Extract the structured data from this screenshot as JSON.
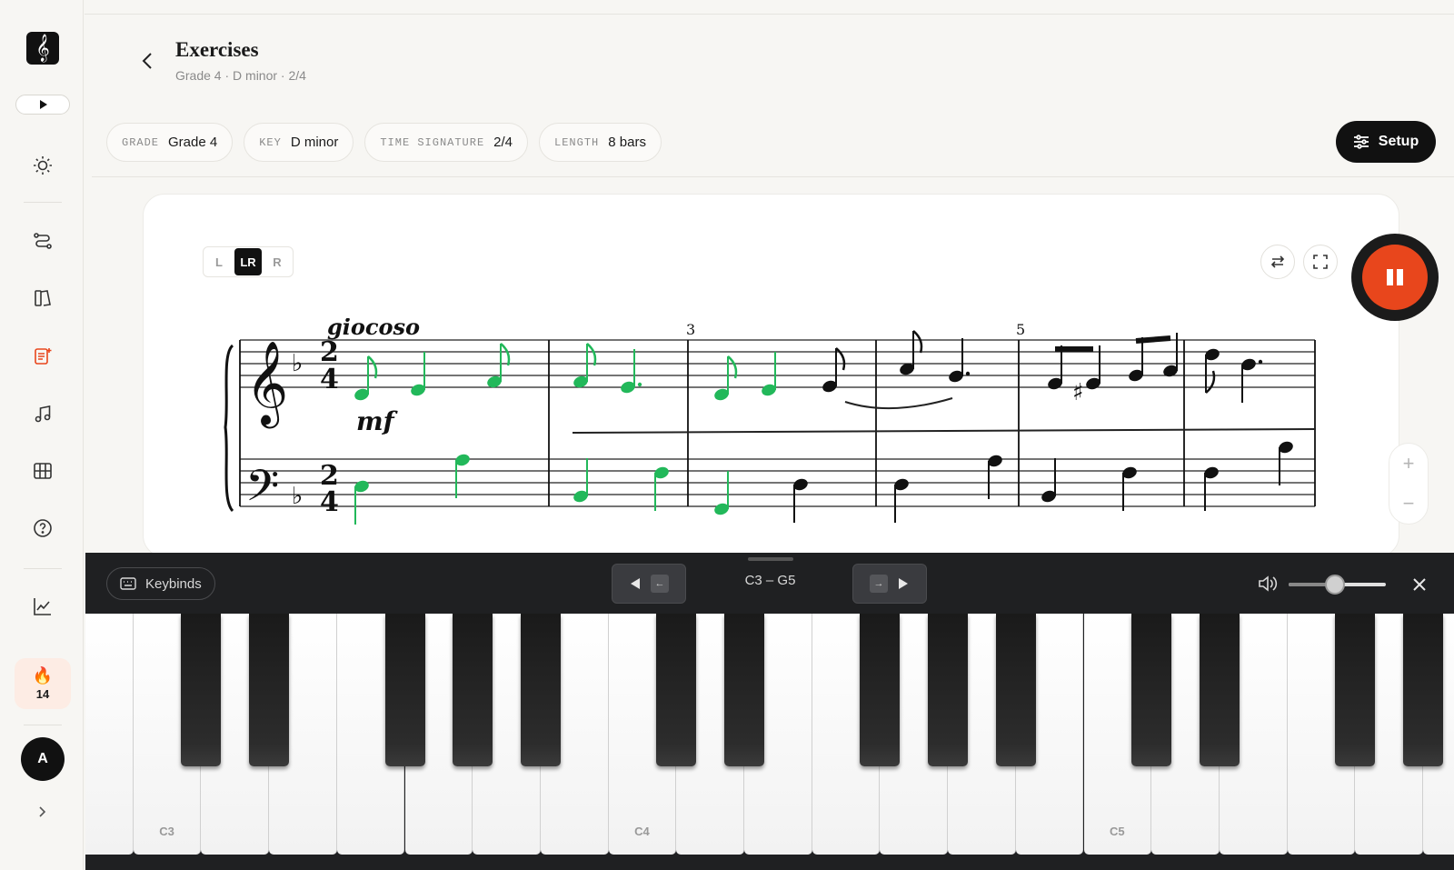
{
  "app": {
    "logo_glyph": "𝄞"
  },
  "sidebar": {
    "streak_count": "14",
    "avatar_initial": "A",
    "accent": "#e8461c"
  },
  "header": {
    "title": "Exercises",
    "subtitle": "Grade 4 · D minor · 2/4"
  },
  "chips": [
    {
      "label": "GRADE",
      "value": "Grade 4"
    },
    {
      "label": "KEY",
      "value": "D minor"
    },
    {
      "label": "TIME SIGNATURE",
      "value": "2/4"
    },
    {
      "label": "LENGTH",
      "value": "8 bars"
    }
  ],
  "setup_label": "Setup",
  "hands": {
    "left": "L",
    "both": "LR",
    "right": "R",
    "selected": "LR"
  },
  "score": {
    "tempo_marking": "giocoso",
    "dynamic": "mf",
    "time_signature_top": "2",
    "time_signature_bottom": "4",
    "measure_numbers": [
      "3",
      "5"
    ],
    "played_color": "#22b85a"
  },
  "piano": {
    "keybinds_label": "Keybinds",
    "range_label": "C3 – G5",
    "prev_key_hint": "←",
    "next_key_hint": "→",
    "volume_level": 0.5,
    "octave_labels": [
      "C3",
      "C4",
      "C5"
    ]
  }
}
